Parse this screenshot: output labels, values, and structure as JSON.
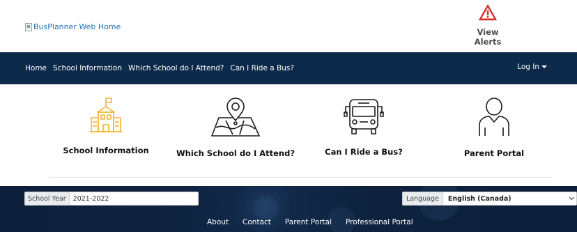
{
  "header": {
    "logo_alt": "BusPlanner Web Home",
    "alerts_label": "View Alerts"
  },
  "nav": {
    "items": [
      {
        "label": "Home"
      },
      {
        "label": "School Information"
      },
      {
        "label": "Which School do I Attend?"
      },
      {
        "label": "Can I Ride a Bus?"
      }
    ],
    "login_label": "Log In"
  },
  "tiles": [
    {
      "label": "School Information",
      "icon": "school-icon"
    },
    {
      "label": "Which School do I Attend?",
      "icon": "map-pin-icon"
    },
    {
      "label": "Can I Ride a Bus?",
      "icon": "bus-icon"
    },
    {
      "label": "Parent Portal",
      "icon": "person-icon"
    }
  ],
  "footer": {
    "school_year_label": "School Year",
    "school_year_value": "2021-2022",
    "language_label": "Language",
    "language_value": "English (Canada)",
    "links": [
      {
        "label": "About"
      },
      {
        "label": "Contact"
      },
      {
        "label": "Parent Portal"
      },
      {
        "label": "Professional Portal"
      }
    ]
  },
  "colors": {
    "nav_bg": "#0d2a4a",
    "alert_red": "#e53935",
    "school_icon": "#f5b335",
    "link_blue": "#1f6fb2"
  }
}
